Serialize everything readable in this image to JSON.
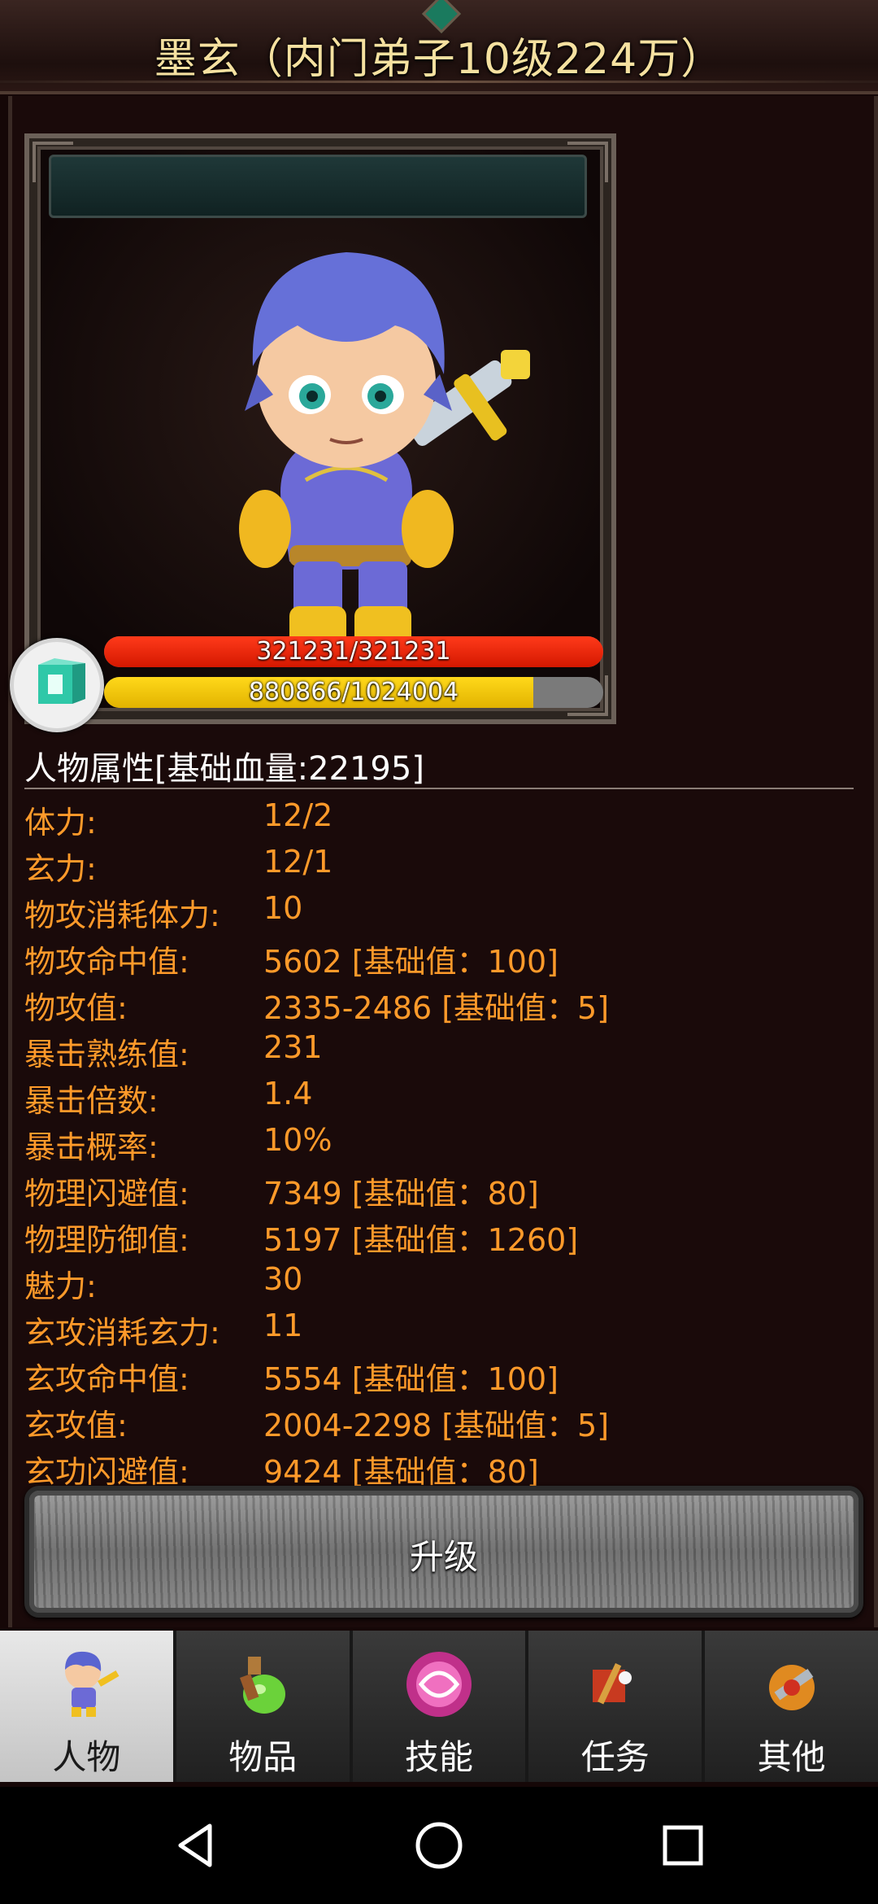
{
  "header": {
    "title": "墨玄（内门弟子10级224万）"
  },
  "status": {
    "hp_text": "321231/321231",
    "hp_fraction": 1.0,
    "mp_text": "880866/1024004",
    "mp_fraction": 0.86
  },
  "attributes": {
    "title": "人物属性[基础血量:22195]",
    "rows": [
      {
        "label": "体力:",
        "value": "12/2"
      },
      {
        "label": "玄力:",
        "value": "12/1"
      },
      {
        "label": "物攻消耗体力:",
        "value": "10"
      },
      {
        "label": "物攻命中值:",
        "value": "5602 [基础值：100]"
      },
      {
        "label": "物攻值:",
        "value": "2335-2486 [基础值：5]"
      },
      {
        "label": "暴击熟练值:",
        "value": "231"
      },
      {
        "label": "暴击倍数:",
        "value": "1.4"
      },
      {
        "label": "暴击概率:",
        "value": "10%"
      },
      {
        "label": "物理闪避值:",
        "value": "7349 [基础值：80]"
      },
      {
        "label": "物理防御值:",
        "value": "5197 [基础值：1260]"
      },
      {
        "label": "魅力:",
        "value": "30"
      },
      {
        "label": "玄攻消耗玄力:",
        "value": "11"
      },
      {
        "label": "玄攻命中值:",
        "value": "5554 [基础值：100]"
      },
      {
        "label": "玄攻值:",
        "value": "2004-2298 [基础值：5]"
      },
      {
        "label": "玄功闪避值:",
        "value": "9424 [基础值：80]"
      }
    ]
  },
  "upgrade_button": {
    "label": "升级"
  },
  "tabs": [
    {
      "label": "人物",
      "icon": "character-icon",
      "active": true
    },
    {
      "label": "物品",
      "icon": "potion-icon",
      "active": false
    },
    {
      "label": "技能",
      "icon": "skill-orb-icon",
      "active": false
    },
    {
      "label": "任务",
      "icon": "quest-icon",
      "active": false
    },
    {
      "label": "其他",
      "icon": "other-icon",
      "active": false
    }
  ],
  "colors": {
    "attribute_text": "#ff9a2a",
    "title_text": "#f5e1a0",
    "hp_bar": "#e52a0a",
    "mp_bar": "#f0c400"
  }
}
